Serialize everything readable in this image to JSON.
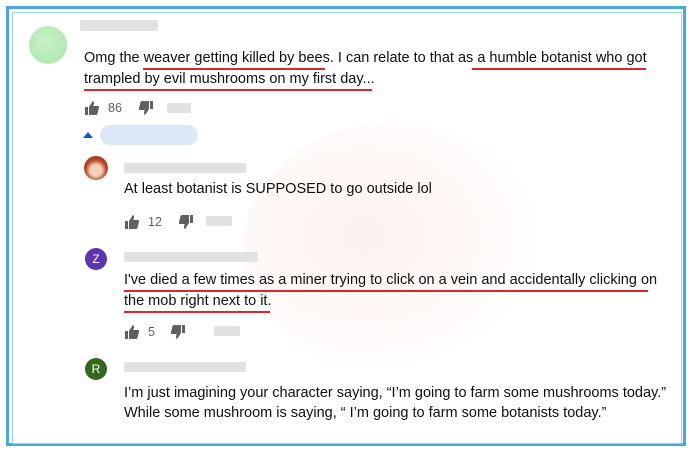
{
  "comments": [
    {
      "text_line1": "Omg the weaver getting killed by bees. I can relate to that as a humble botanist who got",
      "text_line2": "trampled by evil mushrooms on my first day...",
      "likes": "86"
    }
  ],
  "replies": [
    {
      "text_line1": "At least botanist is SUPPOSED to go outside lol",
      "likes": "12"
    },
    {
      "avatar_letter": "Z",
      "avatar_color": "#5e35b1",
      "text_line1": "I've died a few times as a miner trying to click on a vein and accidentally clicking on",
      "text_line2": "the mob right next to it.",
      "likes": "5"
    },
    {
      "avatar_letter": "R",
      "avatar_color": "#33691e",
      "text_line1": "I’m just imagining your character saying, “I’m going to farm some mushrooms today.”",
      "text_line2": "While some mushroom is saying, “ I’m going to farm some botanists today.”"
    }
  ],
  "colors": {
    "frame": "#4aa8d8",
    "underline": "#e0242e",
    "text": "#0f0f0f",
    "reply_toggle": "#065fd4"
  },
  "icons": [
    "thumbs-up-icon",
    "thumbs-down-icon",
    "caret-up-icon"
  ]
}
